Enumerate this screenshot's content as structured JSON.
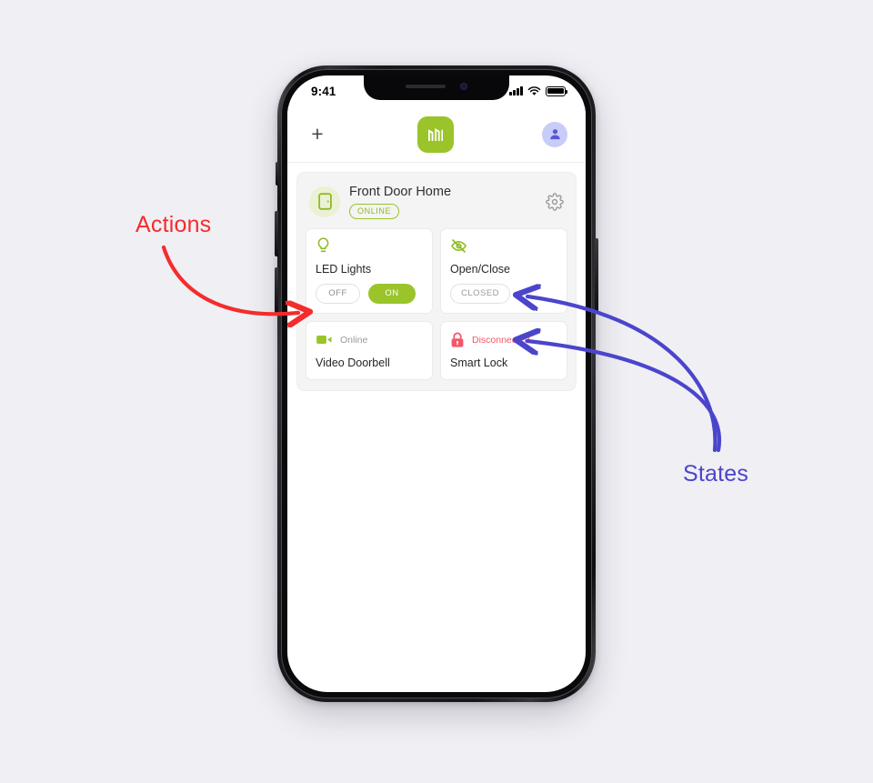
{
  "page": {
    "background": "#f0eff4"
  },
  "annotations": {
    "actions": {
      "label": "Actions",
      "color": "#f42c2c"
    },
    "states": {
      "label": "States",
      "color": "#4b45cc"
    }
  },
  "phone": {
    "status_bar": {
      "time": "9:41",
      "signal_icon": "signal-bars-icon",
      "wifi_icon": "wifi-icon",
      "battery_icon": "battery-full-icon"
    },
    "app_bar": {
      "add_label": "+",
      "add_icon": "plus-icon",
      "logo_icon": "brand-logo-icon",
      "logo_color": "#9ac42a",
      "avatar_icon": "user-avatar-icon",
      "avatar_color": "#c7cdf6"
    },
    "group": {
      "icon": "door-icon",
      "name": "Front Door Home",
      "status": "ONLINE",
      "status_color": "#9ac42a",
      "settings_icon": "gear-icon",
      "tiles": [
        {
          "id": "led-lights",
          "icon": "lightbulb-icon",
          "icon_color": "#9ac42a",
          "title": "LED Lights",
          "controls": [
            {
              "label": "OFF",
              "active": false
            },
            {
              "label": "ON",
              "active": true
            }
          ]
        },
        {
          "id": "open-close",
          "icon": "eye-off-icon",
          "icon_color": "#9ac42a",
          "title": "Open/Close",
          "state": "CLOSED"
        },
        {
          "id": "video-doorbell",
          "icon": "video-camera-icon",
          "icon_color": "#9ac42a",
          "title": "Video Doorbell",
          "status_text": "Online",
          "status_color": "#9a9a9e"
        },
        {
          "id": "smart-lock",
          "icon": "padlock-icon",
          "icon_color": "#f4576a",
          "title": "Smart Lock",
          "status_text": "Disconnected",
          "status_color": "#f4576a"
        }
      ]
    }
  }
}
